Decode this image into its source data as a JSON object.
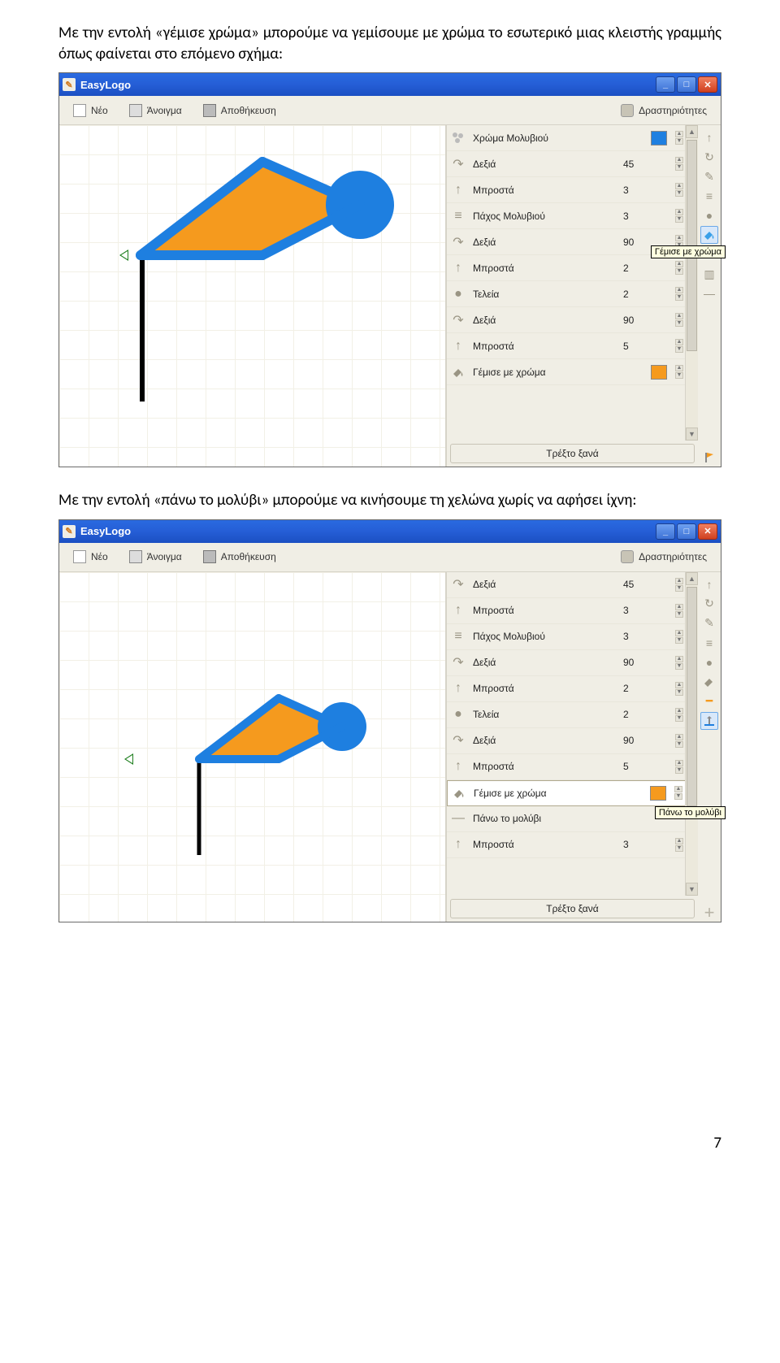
{
  "paragraph1": "Με την εντολή «γέμισε χρώμα» μπορούμε να γεμίσουμε με χρώμα το εσωτερικό μιας κλειστής γραμμής όπως φαίνεται στο επόμενο σχήμα:",
  "paragraph2": "Με την εντολή «πάνω το μολύβι» μπορούμε να κινήσουμε τη χελώνα χωρίς να αφήσει ίχνη:",
  "page_number": "7",
  "window": {
    "title": "EasyLogo",
    "toolbar": {
      "new": "Νέο",
      "open": "Άνοιγμα",
      "save": "Αποθήκευση",
      "activities": "Δραστηριότητες"
    },
    "run_label": "Τρέξτο ξανά"
  },
  "tooltip1": "Γέμισε με χρώμα",
  "tooltip2": "Πάνω το μολύβι",
  "shot1_commands": [
    {
      "icon": "color",
      "label": "Χρώμα Μολυβιού",
      "swatch": "#1e7fe0",
      "spin": true
    },
    {
      "icon": "right",
      "label": "Δεξιά",
      "value": "45",
      "spin": true
    },
    {
      "icon": "fwd",
      "label": "Μπροστά",
      "value": "3",
      "spin": true
    },
    {
      "icon": "width",
      "label": "Πάχος Μολυβιού",
      "value": "3",
      "spin": true
    },
    {
      "icon": "right",
      "label": "Δεξιά",
      "value": "90",
      "spin": true
    },
    {
      "icon": "fwd",
      "label": "Μπροστά",
      "value": "2",
      "spin": true
    },
    {
      "icon": "dot",
      "label": "Τελεία",
      "value": "2",
      "spin": true
    },
    {
      "icon": "right",
      "label": "Δεξιά",
      "value": "90",
      "spin": true
    },
    {
      "icon": "fwd",
      "label": "Μπροστά",
      "value": "5",
      "spin": true
    },
    {
      "icon": "fill",
      "label": "Γέμισε με χρώμα",
      "swatch": "#f59a1e",
      "spin": true
    }
  ],
  "shot2_commands": [
    {
      "icon": "right",
      "label": "Δεξιά",
      "value": "45",
      "spin": true
    },
    {
      "icon": "fwd",
      "label": "Μπροστά",
      "value": "3",
      "spin": true
    },
    {
      "icon": "width",
      "label": "Πάχος Μολυβιού",
      "value": "3",
      "spin": true
    },
    {
      "icon": "right",
      "label": "Δεξιά",
      "value": "90",
      "spin": true
    },
    {
      "icon": "fwd",
      "label": "Μπροστά",
      "value": "2",
      "spin": true
    },
    {
      "icon": "dot",
      "label": "Τελεία",
      "value": "2",
      "spin": true
    },
    {
      "icon": "right",
      "label": "Δεξιά",
      "value": "90",
      "spin": true
    },
    {
      "icon": "fwd",
      "label": "Μπροστά",
      "value": "5",
      "spin": true
    },
    {
      "icon": "fill",
      "label": "Γέμισε με χρώμα",
      "swatch": "#f59a1e",
      "spin": true,
      "sel": true
    },
    {
      "icon": "penup",
      "label": "Πάνω το μολύβι"
    },
    {
      "icon": "fwd",
      "label": "Μπροστά",
      "value": "3",
      "spin": true
    }
  ]
}
